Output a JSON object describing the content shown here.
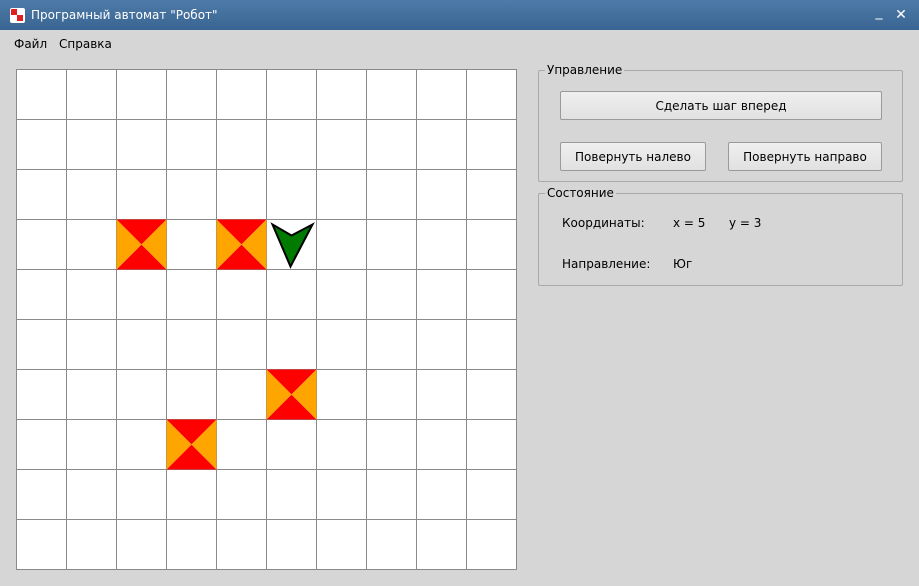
{
  "window": {
    "title": "Програмный автомат \"Робот\"",
    "minimize_glyph": "_",
    "close_glyph": "✕"
  },
  "menu": [
    {
      "label": "Файл"
    },
    {
      "label": "Справка"
    }
  ],
  "board": {
    "rows": 10,
    "cols": 10,
    "obstacles": [
      {
        "col": 3,
        "row": 4
      },
      {
        "col": 5,
        "row": 4
      },
      {
        "col": 6,
        "row": 7
      },
      {
        "col": 4,
        "row": 8
      }
    ],
    "robot": {
      "col": 6,
      "row": 4,
      "direction": "south"
    },
    "colors": {
      "grid_line": "#8a8a8a",
      "cell_bg": "#ffffff",
      "obstacle_orange": "#ffa500",
      "obstacle_red": "#ff0000",
      "robot_fill": "#007a00",
      "robot_outline": "#000000"
    }
  },
  "controls": {
    "legend": "Управление",
    "step_forward": "Сделать шаг вперед",
    "turn_left": "Повернуть налево",
    "turn_right": "Повернуть направо"
  },
  "state": {
    "legend": "Состояние",
    "coords_label": "Координаты:",
    "x_text": "x = 5",
    "y_text": "y = 3",
    "direction_label": "Направление:",
    "direction_value": "Юг"
  },
  "colors": {
    "titlebar": "#3f6c9b",
    "window_bg": "#d6d6d6"
  }
}
